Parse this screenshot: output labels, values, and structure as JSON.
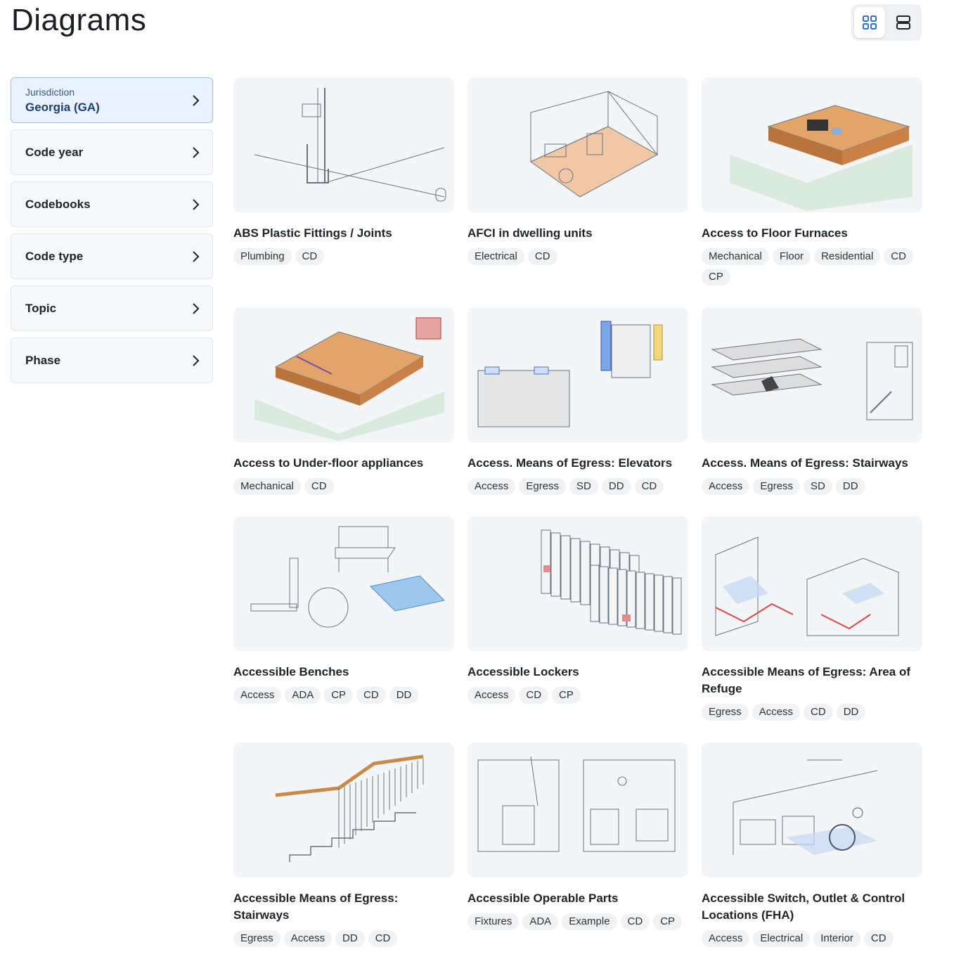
{
  "page": {
    "title": "Diagrams"
  },
  "view_toggle": {
    "grid_icon": "grid-view-icon",
    "list_icon": "list-view-icon",
    "active": "grid"
  },
  "filters": [
    {
      "label": "Jurisdiction",
      "value": "Georgia (GA)"
    },
    {
      "label": "Code year"
    },
    {
      "label": "Codebooks"
    },
    {
      "label": "Code type"
    },
    {
      "label": "Topic"
    },
    {
      "label": "Phase"
    }
  ],
  "colors": {
    "accent": "#1d3f72",
    "selected_bg": "#e9f2fe",
    "selected_border": "#9dbef0"
  },
  "diagrams": [
    {
      "title": "ABS Plastic Fittings / Joints",
      "tags": [
        "Plumbing",
        "CD"
      ],
      "icon": "plumbing-diagram"
    },
    {
      "title": "AFCI in dwelling units",
      "tags": [
        "Electrical",
        "CD"
      ],
      "icon": "floor-plan-diagram"
    },
    {
      "title": "Access to Floor Furnaces",
      "tags": [
        "Mechanical",
        "Floor",
        "Residential",
        "CD",
        "CP"
      ],
      "icon": "floor-furnace-diagram"
    },
    {
      "title": "Access to Under-floor appliances",
      "tags": [
        "Mechanical",
        "CD"
      ],
      "icon": "underfloor-diagram"
    },
    {
      "title": "Access. Means of Egress: Elevators",
      "tags": [
        "Access",
        "Egress",
        "SD",
        "DD",
        "CD"
      ],
      "icon": "elevator-diagram"
    },
    {
      "title": "Access. Means of Egress: Stairways",
      "tags": [
        "Access",
        "Egress",
        "SD",
        "DD"
      ],
      "icon": "stairway-diagram"
    },
    {
      "title": "Accessible Benches",
      "tags": [
        "Access",
        "ADA",
        "CP",
        "CD",
        "DD"
      ],
      "icon": "bench-diagram"
    },
    {
      "title": "Accessible Lockers",
      "tags": [
        "Access",
        "CD",
        "CP"
      ],
      "icon": "locker-diagram"
    },
    {
      "title": "Accessible Means of Egress: Area of Refuge",
      "tags": [
        "Egress",
        "Access",
        "CD",
        "DD"
      ],
      "icon": "refuge-diagram"
    },
    {
      "title": "Accessible Means of Egress: Stairways",
      "tags": [
        "Egress",
        "Access",
        "DD",
        "CD"
      ],
      "icon": "handrail-diagram"
    },
    {
      "title": "Accessible Operable Parts",
      "tags": [
        "Fixtures",
        "ADA",
        "Example",
        "CD",
        "CP"
      ],
      "icon": "operable-parts-diagram"
    },
    {
      "title": "Accessible Switch, Outlet & Control Locations (FHA)",
      "tags": [
        "Access",
        "Electrical",
        "Interior",
        "CD"
      ],
      "icon": "switch-location-diagram"
    }
  ]
}
